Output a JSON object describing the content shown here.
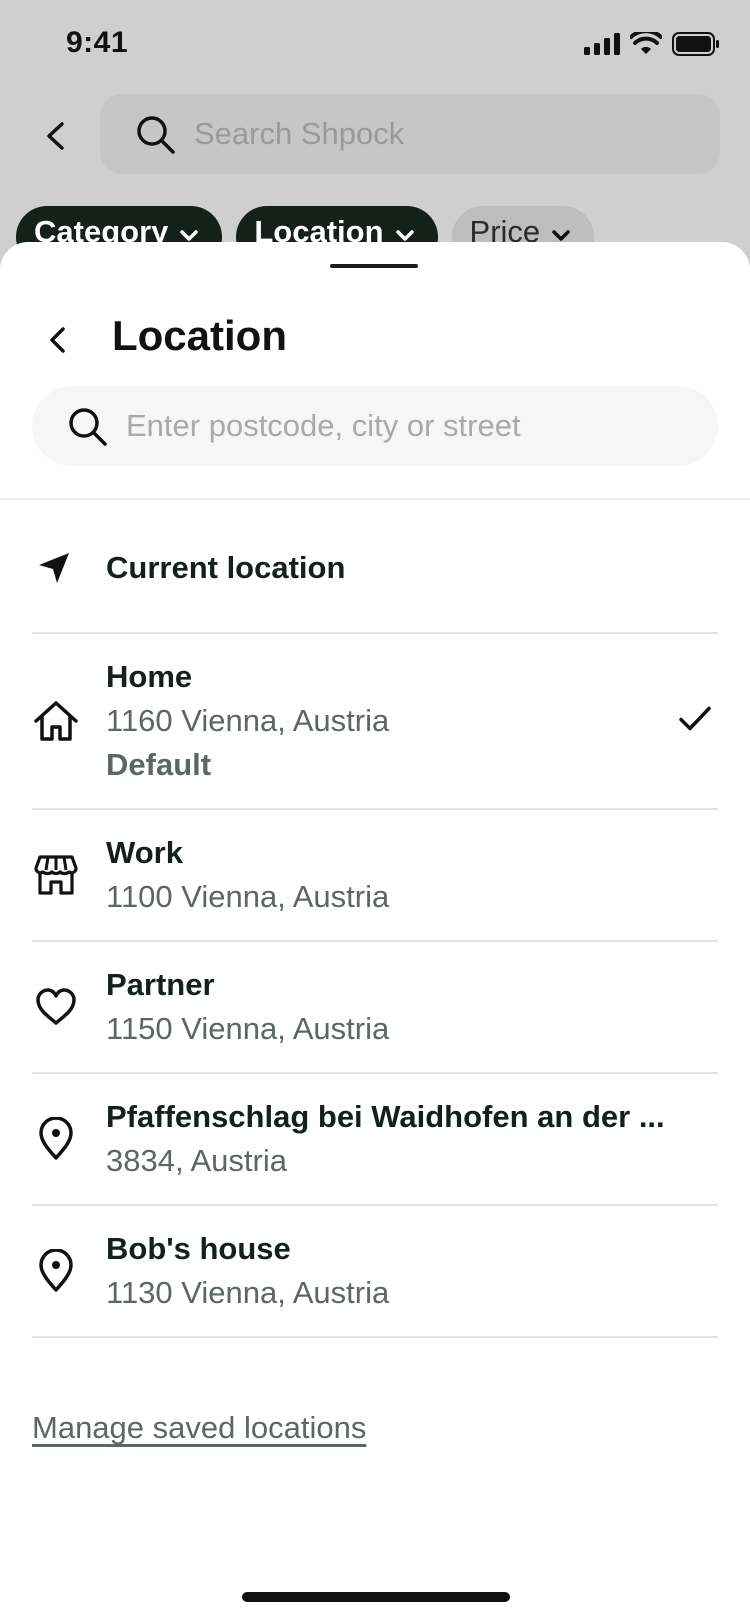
{
  "status_bar": {
    "time": "9:41"
  },
  "background": {
    "search_placeholder": "Search Shpock",
    "chips": [
      {
        "label": "Category"
      },
      {
        "label": "Location"
      },
      {
        "label": "Price"
      }
    ]
  },
  "sheet": {
    "title": "Location",
    "search_placeholder": "Enter postcode, city or street",
    "current_location_label": "Current location",
    "locations": [
      {
        "name": "Home",
        "address": "1160 Vienna, Austria",
        "badge": "Default",
        "icon": "home-icon",
        "selected": true
      },
      {
        "name": "Work",
        "address": "1100 Vienna, Austria",
        "icon": "store-icon",
        "selected": false
      },
      {
        "name": "Partner",
        "address": "1150 Vienna, Austria",
        "icon": "heart-icon",
        "selected": false
      },
      {
        "name": "Pfaffenschlag bei Waidhofen an der ...",
        "address": "3834, Austria",
        "icon": "location-pin-icon",
        "selected": false
      },
      {
        "name": "Bob's house",
        "address": "1130 Vienna, Austria",
        "icon": "location-pin-icon",
        "selected": false
      }
    ],
    "manage_link": "Manage saved locations"
  },
  "colors": {
    "chip_active": "#14201a",
    "text_primary": "#14201a",
    "text_secondary": "#5e6661"
  }
}
